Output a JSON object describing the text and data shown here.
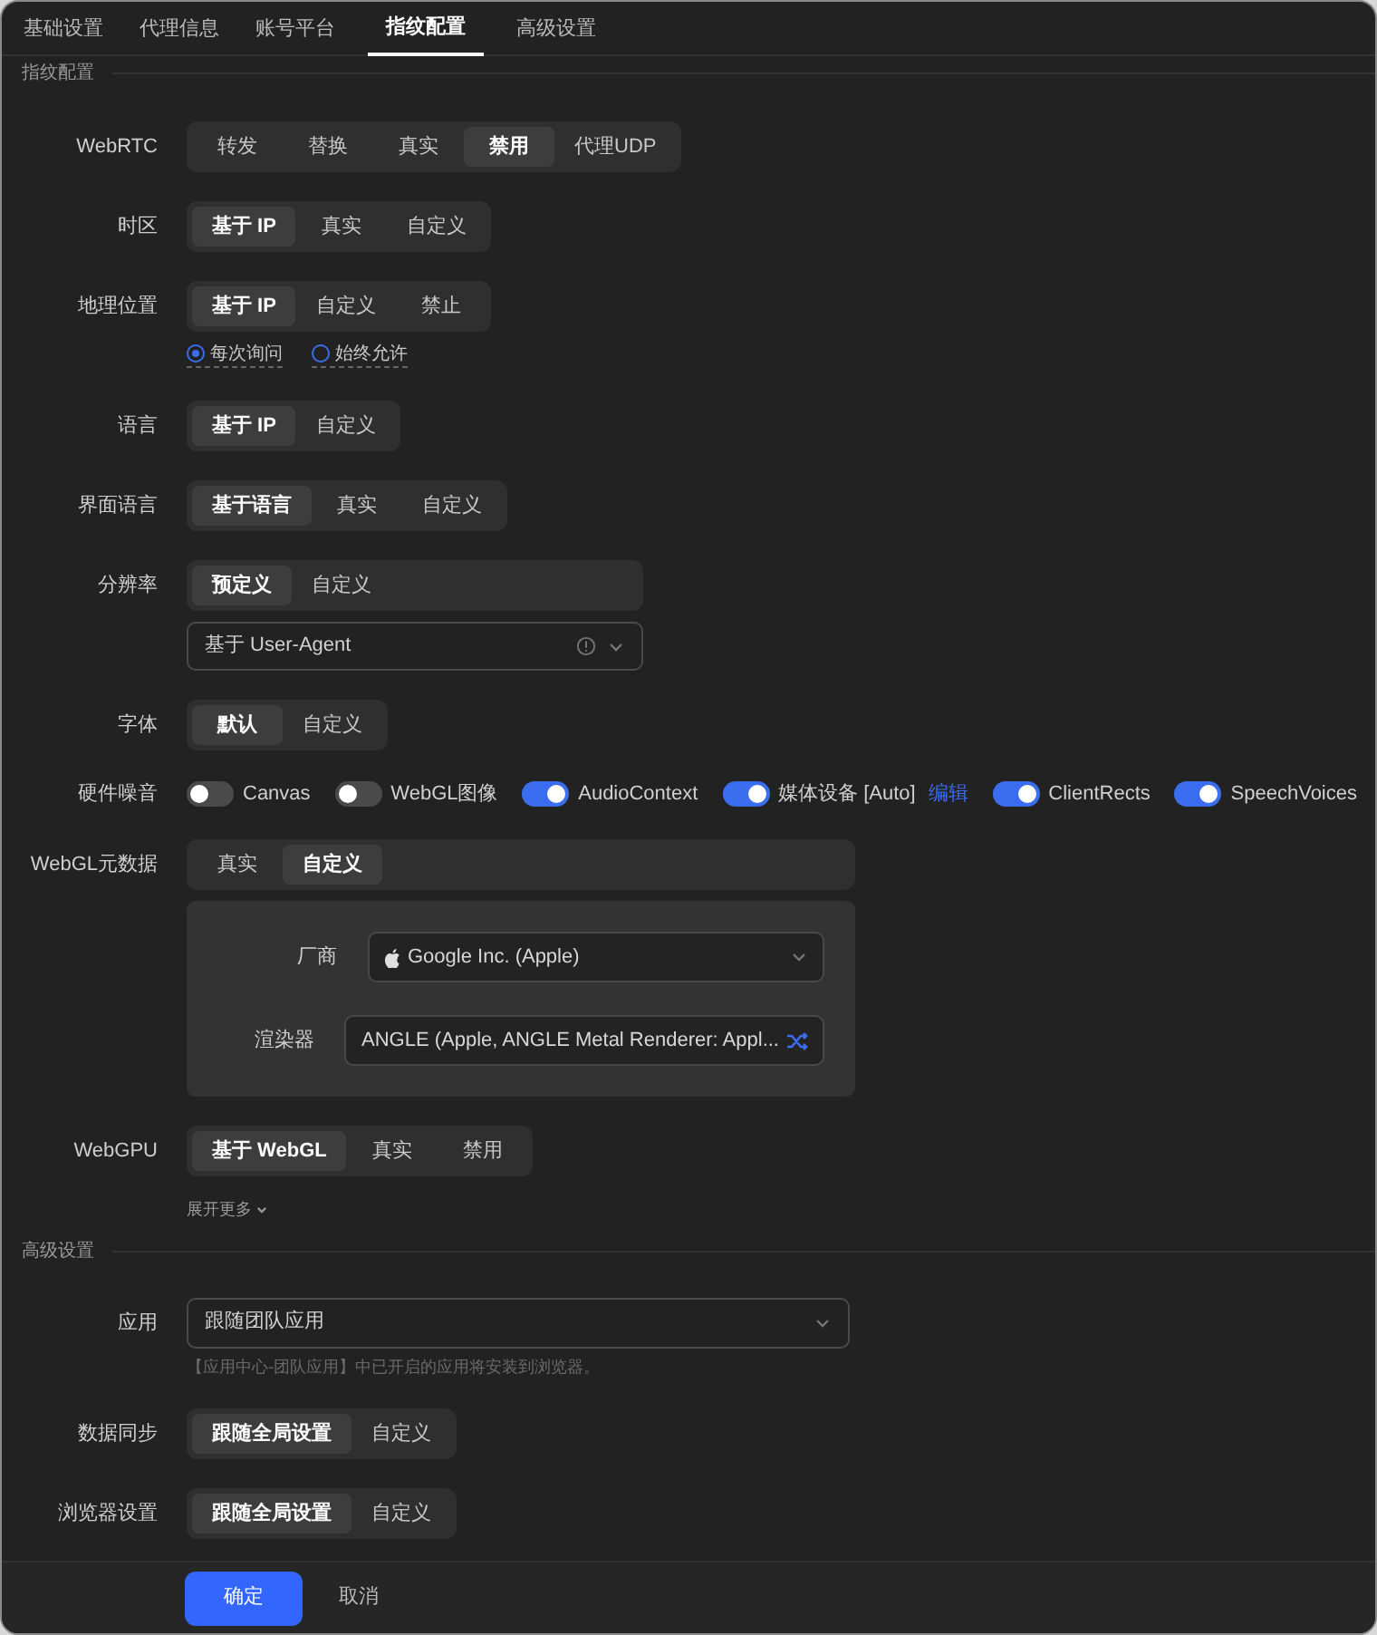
{
  "tabs": [
    {
      "label": "基础设置",
      "selected": false
    },
    {
      "label": "代理信息",
      "selected": false
    },
    {
      "label": "账号平台",
      "selected": false
    },
    {
      "label": "指纹配置",
      "selected": true
    },
    {
      "label": "高级设置",
      "selected": false
    }
  ],
  "sections": [
    {
      "title": "指纹配置",
      "rows": [
        {
          "kind": "segmented",
          "label": "WebRTC",
          "options": [
            {
              "label": "转发",
              "selected": false
            },
            {
              "label": "替换",
              "selected": false
            },
            {
              "label": "真实",
              "selected": false
            },
            {
              "label": "禁用",
              "selected": true
            },
            {
              "label": "代理UDP",
              "selected": false
            }
          ]
        },
        {
          "kind": "segmented",
          "label": "时区",
          "options": [
            {
              "label": "基于 IP",
              "selected": true
            },
            {
              "label": "真实",
              "selected": false
            },
            {
              "label": "自定义",
              "selected": false
            }
          ]
        },
        {
          "kind": "segmented",
          "label": "地理位置",
          "options": [
            {
              "label": "基于 IP",
              "selected": true
            },
            {
              "label": "自定义",
              "selected": false
            },
            {
              "label": "禁止",
              "selected": false
            }
          ],
          "radios": [
            {
              "label": "每次询问",
              "selected": true
            },
            {
              "label": "始终允许",
              "selected": false
            }
          ]
        },
        {
          "kind": "segmented",
          "label": "语言",
          "options": [
            {
              "label": "基于 IP",
              "selected": true
            },
            {
              "label": "自定义",
              "selected": false
            }
          ]
        },
        {
          "kind": "segmented",
          "label": "界面语言",
          "options": [
            {
              "label": "基于语言",
              "selected": true
            },
            {
              "label": "真实",
              "selected": false
            },
            {
              "label": "自定义",
              "selected": false
            }
          ]
        },
        {
          "kind": "segmented",
          "label": "分辨率",
          "options": [
            {
              "label": "预定义",
              "selected": true
            },
            {
              "label": "自定义",
              "selected": false
            }
          ],
          "select": {
            "value": "基于 User-Agent",
            "info": true
          }
        },
        {
          "kind": "segmented",
          "label": "字体",
          "options": [
            {
              "label": "默认",
              "selected": true
            },
            {
              "label": "自定义",
              "selected": false
            }
          ]
        },
        {
          "kind": "toggles",
          "label": "硬件噪音",
          "toggles": [
            {
              "label": "Canvas",
              "on": false
            },
            {
              "label": "WebGL图像",
              "on": false
            },
            {
              "label": "AudioContext",
              "on": true
            },
            {
              "label": "媒体设备 [Auto]",
              "on": true,
              "link": "编辑"
            },
            {
              "label": "ClientRects",
              "on": true
            },
            {
              "label": "SpeechVoices",
              "on": true
            }
          ]
        },
        {
          "kind": "segmented",
          "label": "WebGL元数据",
          "options": [
            {
              "label": "真实",
              "selected": false
            },
            {
              "label": "自定义",
              "selected": true
            }
          ],
          "panel": [
            {
              "label": "厂商",
              "value": "Google Inc. (Apple)",
              "kind": "dropdown"
            },
            {
              "label": "渲染器",
              "value": "ANGLE (Apple, ANGLE Metal Renderer: Appl...",
              "kind": "shuffle"
            }
          ]
        },
        {
          "kind": "segmented",
          "label": "WebGPU",
          "options": [
            {
              "label": "基于 WebGL",
              "selected": true
            },
            {
              "label": "真实",
              "selected": false
            },
            {
              "label": "禁用",
              "selected": false
            }
          ]
        },
        {
          "kind": "expand",
          "label": "展开更多"
        }
      ]
    },
    {
      "title": "高级设置",
      "rows": [
        {
          "kind": "select",
          "label": "应用",
          "value": "跟随团队应用",
          "hint": "【应用中心-团队应用】中已开启的应用将安装到浏览器。"
        },
        {
          "kind": "segmented",
          "label": "数据同步",
          "options": [
            {
              "label": "跟随全局设置",
              "selected": true
            },
            {
              "label": "自定义",
              "selected": false
            }
          ]
        },
        {
          "kind": "segmented",
          "label": "浏览器设置",
          "options": [
            {
              "label": "跟随全局设置",
              "selected": true
            },
            {
              "label": "自定义",
              "selected": false
            }
          ]
        }
      ]
    }
  ],
  "footer": {
    "confirm": "确定",
    "cancel": "取消"
  }
}
